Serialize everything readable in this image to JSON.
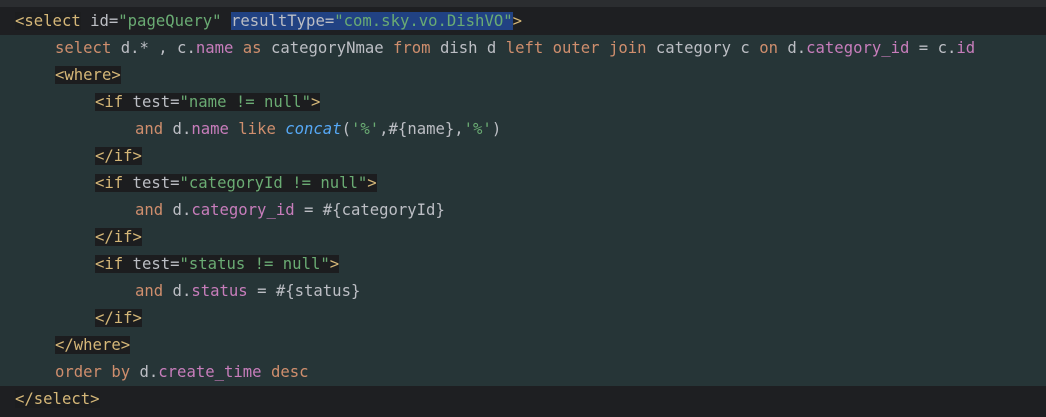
{
  "editor": {
    "lines": [
      {
        "indent": 1,
        "tokens": [
          {
            "t": "<select",
            "c": "tag",
            "bg": "tag"
          },
          {
            "t": " ",
            "c": "txt"
          },
          {
            "t": "id=",
            "c": "attr"
          },
          {
            "t": "\"pageQuery\"",
            "c": "str"
          },
          {
            "t": " ",
            "c": "txt"
          },
          {
            "t": "resultType=",
            "c": "attr",
            "bg": "sel"
          },
          {
            "t": "\"com.sky.vo.DishVO\"",
            "c": "str",
            "bg": "sel"
          },
          {
            "t": ">",
            "c": "tag"
          }
        ]
      },
      {
        "indent": 5,
        "tokens": [
          {
            "t": "select",
            "c": "kw"
          },
          {
            "t": " d.* , c.",
            "c": "txt"
          },
          {
            "t": "name",
            "c": "field"
          },
          {
            "t": " ",
            "c": "txt"
          },
          {
            "t": "as",
            "c": "kw"
          },
          {
            "t": " categoryNmae ",
            "c": "txt"
          },
          {
            "t": "from",
            "c": "kw"
          },
          {
            "t": " dish d ",
            "c": "txt"
          },
          {
            "t": "left outer join",
            "c": "kw"
          },
          {
            "t": " category c ",
            "c": "txt"
          },
          {
            "t": "on",
            "c": "kw"
          },
          {
            "t": " d.",
            "c": "txt"
          },
          {
            "t": "category_id",
            "c": "field"
          },
          {
            "t": " = c.",
            "c": "txt"
          },
          {
            "t": "id",
            "c": "field"
          }
        ]
      },
      {
        "indent": 5,
        "tokens": [
          {
            "t": "<where>",
            "c": "tag",
            "bg": "tag"
          }
        ]
      },
      {
        "indent": 9,
        "tokens": [
          {
            "t": "<if",
            "c": "tag",
            "bg": "tag"
          },
          {
            "t": " test=",
            "c": "attr",
            "bg": "tag"
          },
          {
            "t": "\"name != null\"",
            "c": "str",
            "bg": "tag"
          },
          {
            "t": ">",
            "c": "tag",
            "bg": "tag"
          }
        ]
      },
      {
        "indent": 13,
        "tokens": [
          {
            "t": "and",
            "c": "kw"
          },
          {
            "t": " d.",
            "c": "txt"
          },
          {
            "t": "name",
            "c": "field"
          },
          {
            "t": " ",
            "c": "txt"
          },
          {
            "t": "like",
            "c": "kw"
          },
          {
            "t": " ",
            "c": "txt"
          },
          {
            "t": "concat",
            "c": "fn"
          },
          {
            "t": "(",
            "c": "txt"
          },
          {
            "t": "'%'",
            "c": "str"
          },
          {
            "t": ",#{name},",
            "c": "txt"
          },
          {
            "t": "'%'",
            "c": "str"
          },
          {
            "t": ")",
            "c": "txt"
          }
        ]
      },
      {
        "indent": 9,
        "tokens": [
          {
            "t": "</if>",
            "c": "tag",
            "bg": "tag"
          }
        ]
      },
      {
        "indent": 9,
        "tokens": [
          {
            "t": "<if",
            "c": "tag",
            "bg": "tag"
          },
          {
            "t": " test=",
            "c": "attr",
            "bg": "tag"
          },
          {
            "t": "\"categoryId != null\"",
            "c": "str",
            "bg": "tag"
          },
          {
            "t": ">",
            "c": "tag",
            "bg": "tag"
          }
        ]
      },
      {
        "indent": 13,
        "tokens": [
          {
            "t": "and",
            "c": "kw"
          },
          {
            "t": " d.",
            "c": "txt"
          },
          {
            "t": "category_id",
            "c": "field"
          },
          {
            "t": " = #{categoryId}",
            "c": "txt"
          }
        ]
      },
      {
        "indent": 9,
        "tokens": [
          {
            "t": "</if>",
            "c": "tag",
            "bg": "tag"
          }
        ]
      },
      {
        "indent": 9,
        "tokens": [
          {
            "t": "<if",
            "c": "tag",
            "bg": "tag"
          },
          {
            "t": " test=",
            "c": "attr",
            "bg": "tag"
          },
          {
            "t": "\"status != null\"",
            "c": "str",
            "bg": "tag"
          },
          {
            "t": ">",
            "c": "tag",
            "bg": "tag"
          }
        ]
      },
      {
        "indent": 13,
        "tokens": [
          {
            "t": "and",
            "c": "kw"
          },
          {
            "t": " d.",
            "c": "txt"
          },
          {
            "t": "status",
            "c": "field"
          },
          {
            "t": " = #{status}",
            "c": "txt"
          }
        ]
      },
      {
        "indent": 9,
        "tokens": [
          {
            "t": "</if>",
            "c": "tag",
            "bg": "tag"
          }
        ]
      },
      {
        "indent": 5,
        "tokens": [
          {
            "t": "</where>",
            "c": "tag",
            "bg": "tag"
          }
        ]
      },
      {
        "indent": 5,
        "tokens": [
          {
            "t": "order by",
            "c": "kw"
          },
          {
            "t": " d.",
            "c": "txt"
          },
          {
            "t": "create_time",
            "c": "field"
          },
          {
            "t": " ",
            "c": "txt"
          },
          {
            "t": "desc",
            "c": "kw"
          }
        ]
      },
      {
        "indent": 1,
        "tokens": [
          {
            "t": "</select>",
            "c": "tag",
            "bg": "tag"
          }
        ]
      }
    ]
  },
  "colors": {
    "editor_bg": "#1e1f22",
    "injected_sql_bg": "#263537",
    "selection_bg": "#214283",
    "tag": "#d5b778",
    "string": "#6aab73",
    "keyword": "#cf8e6d",
    "field": "#c77dbb",
    "function": "#56a8f5",
    "text": "#bcbec4"
  }
}
